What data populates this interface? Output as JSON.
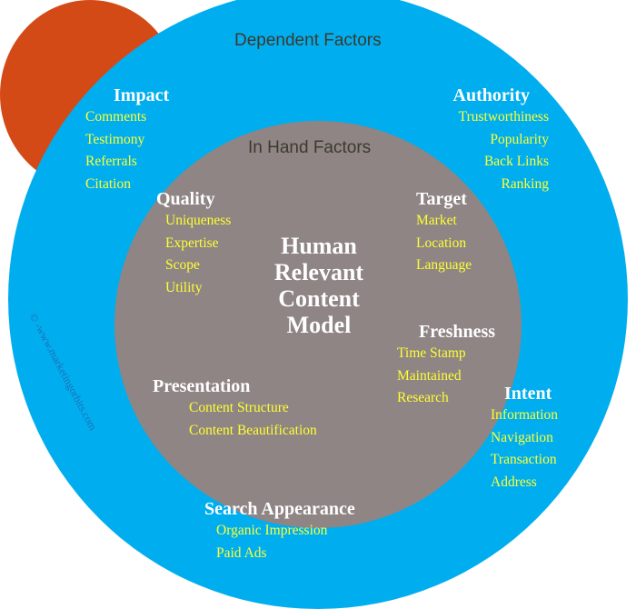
{
  "outer_ring": {
    "title": "Dependent Factors",
    "color": "#00aeef",
    "groups": {
      "impact": {
        "heading": "Impact",
        "items": [
          "Comments",
          "Testimony",
          "Referrals",
          "Citation"
        ]
      },
      "authority": {
        "heading": "Authority",
        "items": [
          "Trustworthiness",
          "Popularity",
          "Back Links",
          "Ranking"
        ]
      },
      "intent": {
        "heading": "Intent",
        "items": [
          "Information",
          "Navigation",
          "Transaction",
          "Address"
        ]
      },
      "search_appearance": {
        "heading": "Search Appearance",
        "items": [
          "Organic Impression",
          "Paid Ads"
        ]
      }
    }
  },
  "middle_ring": {
    "title": "In Hand Factors",
    "color": "#8e8584",
    "groups": {
      "quality": {
        "heading": "Quality",
        "items": [
          "Uniqueness",
          "Expertise",
          "Scope",
          "Utility"
        ]
      },
      "target": {
        "heading": "Target",
        "items": [
          "Market",
          "Location",
          "Language"
        ]
      },
      "freshness": {
        "heading": "Freshness",
        "items": [
          "Time Stamp",
          "Maintained",
          "Research"
        ]
      },
      "presentation": {
        "heading": "Presentation",
        "items": [
          "Content Structure",
          "Content Beautification"
        ]
      }
    }
  },
  "core": {
    "lines": [
      "Human",
      "Relevant",
      "Content",
      "Model"
    ],
    "color": "#d44a17"
  },
  "watermark": "© -www.marketingorbits.com",
  "colors": {
    "heading": "#ffffff",
    "item": "#ffff33",
    "ring_title": "#3d3a2e"
  }
}
